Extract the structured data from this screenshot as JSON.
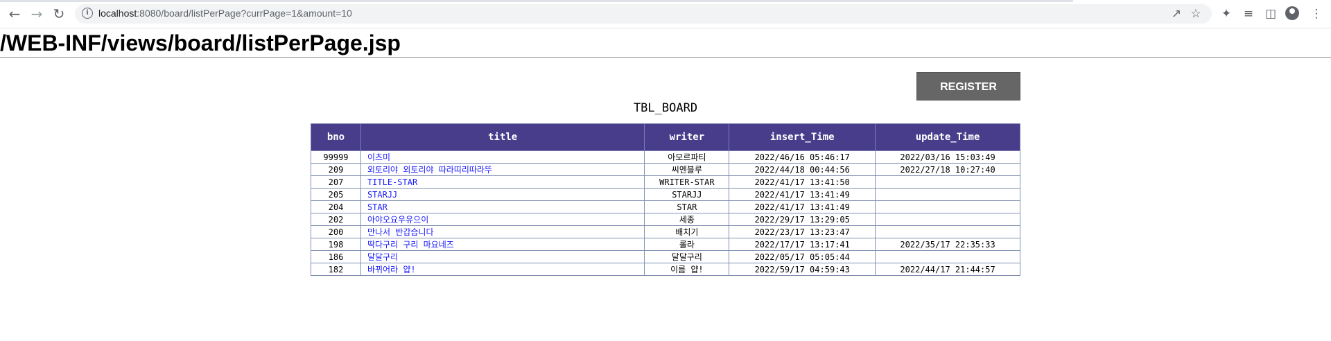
{
  "browser": {
    "url_host": "localhost",
    "url_path": ":8080/board/listPerPage?currPage=1&amount=10"
  },
  "page": {
    "heading": "/WEB-INF/views/board/listPerPage.jsp",
    "register_label": "REGISTER",
    "caption": "TBL_BOARD"
  },
  "table": {
    "headers": [
      "bno",
      "title",
      "writer",
      "insert_Time",
      "update_Time"
    ],
    "rows": [
      {
        "bno": "99999",
        "title": "이츠미",
        "writer": "아모르파티",
        "insert": "2022/46/16 05:46:17",
        "update": "2022/03/16 15:03:49"
      },
      {
        "bno": "209",
        "title": "외토리야 외토리야 따라띠리따라뚜",
        "writer": "씨엔블루",
        "insert": "2022/44/18 00:44:56",
        "update": "2022/27/18 10:27:40"
      },
      {
        "bno": "207",
        "title": "TITLE-STAR",
        "writer": "WRITER-STAR",
        "insert": "2022/41/17 13:41:50",
        "update": ""
      },
      {
        "bno": "205",
        "title": "STARJJ",
        "writer": "STARJJ",
        "insert": "2022/41/17 13:41:49",
        "update": ""
      },
      {
        "bno": "204",
        "title": "STAR",
        "writer": "STAR",
        "insert": "2022/41/17 13:41:49",
        "update": ""
      },
      {
        "bno": "202",
        "title": "아야오요우유으이",
        "writer": "세종",
        "insert": "2022/29/17 13:29:05",
        "update": ""
      },
      {
        "bno": "200",
        "title": "만나서 반갑습니다",
        "writer": "배치기",
        "insert": "2022/23/17 13:23:47",
        "update": ""
      },
      {
        "bno": "198",
        "title": "딱다구리 구리 마요네즈",
        "writer": "롤라",
        "insert": "2022/17/17 13:17:41",
        "update": "2022/35/17 22:35:33"
      },
      {
        "bno": "186",
        "title": "달달구리",
        "writer": "달달구리",
        "insert": "2022/05/17 05:05:44",
        "update": ""
      },
      {
        "bno": "182",
        "title": "바뀌어라 얍!",
        "writer": "이름 얍!",
        "insert": "2022/59/17 04:59:43",
        "update": "2022/44/17 21:44:57"
      }
    ]
  }
}
